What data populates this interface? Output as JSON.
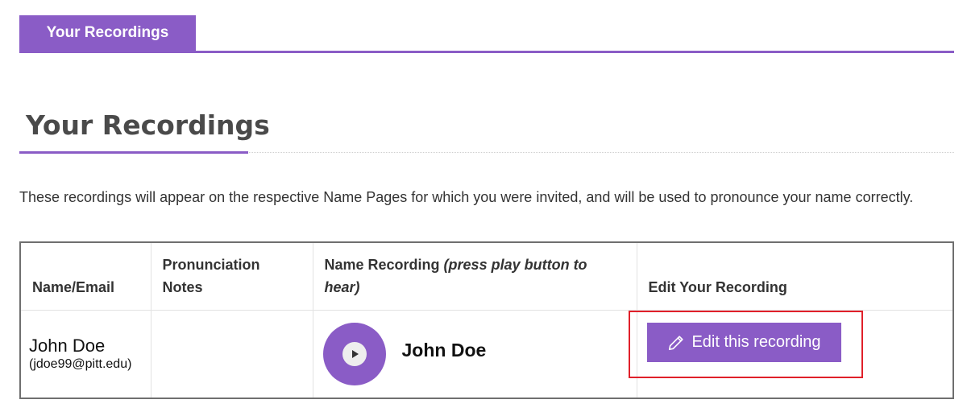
{
  "tabs": {
    "active_label": "Your Recordings"
  },
  "page": {
    "title": "Your Recordings",
    "description": "These recordings will appear on the respective Name Pages for which you were invited, and will be used to pronounce your name correctly."
  },
  "table": {
    "headers": {
      "name_email": "Name/Email",
      "notes": "Pronunciation Notes",
      "recording_main": "Name Recording ",
      "recording_hint": "(press play button to hear)",
      "edit": "Edit Your Recording"
    },
    "rows": [
      {
        "name": "John Doe",
        "email": "(jdoe99@pitt.edu)",
        "notes": "",
        "recording_name": "John Doe",
        "edit_label": "Edit this recording"
      }
    ]
  },
  "icons": {
    "play": "play-icon",
    "edit": "pencil-icon"
  },
  "colors": {
    "accent": "#8a5cc6",
    "highlight": "#e0202a"
  }
}
